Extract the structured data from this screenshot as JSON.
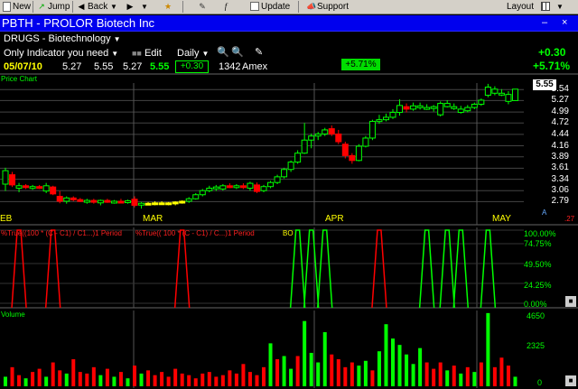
{
  "toolbar": {
    "new": "New",
    "jump": "Jump",
    "back": "Back",
    "update": "Update",
    "support": "Support",
    "layout": "Layout"
  },
  "window": {
    "title": "PBTH - PROLOR Biotech Inc",
    "minimize": "–",
    "close": "×"
  },
  "header": {
    "watchlist": "DRUGS - Biotechnology",
    "indicator": "Only Indicator you need",
    "edit": "Edit",
    "period": "Daily",
    "date": "05/07/10",
    "open": "5.27",
    "high": "5.55",
    "low": "5.27",
    "close": "5.55",
    "change": "+0.30",
    "volume": "1342",
    "exchange": "Amex",
    "pct_badge": "+5.71%",
    "right_change": "+0.30",
    "right_pct": "+5.71%"
  },
  "price_pane": {
    "title": "Price Chart",
    "last_price": "5.55",
    "axis_labels": [
      "5.54",
      "5.27",
      "4.99",
      "4.72",
      "4.44",
      "4.16",
      "3.89",
      "3.61",
      "3.34",
      "3.06",
      "2.79"
    ],
    "months": [
      "EB",
      "MAR",
      "APR",
      "MAY"
    ],
    "corner_letters": "A",
    "corner_value": ".27"
  },
  "indicator_pane": {
    "label1": "%True((100 * (C - C1) / C1...)1 Period",
    "label2": "%True(( 100 * (C - C1) / C...)1 Period",
    "label3": "BO",
    "axis_labels": [
      "100.00%",
      "74.75%",
      "49.50%",
      "24.25%",
      "0.00%"
    ]
  },
  "volume_pane": {
    "title": "Volume",
    "axis_labels": [
      "4650",
      "2325",
      "0"
    ]
  },
  "colors": {
    "up": "#00ff00",
    "down": "#ff0000",
    "neutral": "#ffff00",
    "titlebar": "#0000ee",
    "grid": "#555555"
  },
  "chart_data": {
    "type": "candlestick",
    "y_range": [
      2.6,
      5.7
    ],
    "candles": [
      {
        "o": 3.22,
        "h": 3.62,
        "l": 3.05,
        "c": 3.55,
        "d": "up"
      },
      {
        "o": 3.45,
        "h": 3.52,
        "l": 3.15,
        "c": 3.2,
        "d": "down"
      },
      {
        "o": 3.12,
        "h": 3.25,
        "l": 3.02,
        "c": 3.18,
        "d": "up"
      },
      {
        "o": 3.18,
        "h": 3.22,
        "l": 3.1,
        "c": 3.14,
        "d": "down"
      },
      {
        "o": 3.12,
        "h": 3.2,
        "l": 3.08,
        "c": 3.16,
        "d": "up"
      },
      {
        "o": 3.16,
        "h": 3.2,
        "l": 3.1,
        "c": 3.12,
        "d": "down"
      },
      {
        "o": 3.05,
        "h": 3.25,
        "l": 3.0,
        "c": 3.18,
        "d": "up"
      },
      {
        "o": 3.15,
        "h": 3.18,
        "l": 2.95,
        "c": 2.98,
        "d": "down"
      },
      {
        "o": 2.92,
        "h": 3.05,
        "l": 2.75,
        "c": 2.8,
        "d": "down"
      },
      {
        "o": 2.8,
        "h": 2.92,
        "l": 2.74,
        "c": 2.88,
        "d": "up"
      },
      {
        "o": 2.88,
        "h": 2.92,
        "l": 2.8,
        "c": 2.84,
        "d": "down"
      },
      {
        "o": 2.84,
        "h": 2.88,
        "l": 2.78,
        "c": 2.8,
        "d": "down"
      },
      {
        "o": 2.8,
        "h": 2.86,
        "l": 2.74,
        "c": 2.82,
        "d": "up"
      },
      {
        "o": 2.82,
        "h": 2.86,
        "l": 2.74,
        "c": 2.78,
        "d": "down"
      },
      {
        "o": 2.76,
        "h": 2.84,
        "l": 2.7,
        "c": 2.82,
        "d": "up"
      },
      {
        "o": 2.82,
        "h": 2.86,
        "l": 2.76,
        "c": 2.79,
        "d": "down"
      },
      {
        "o": 2.79,
        "h": 2.83,
        "l": 2.74,
        "c": 2.8,
        "d": "up"
      },
      {
        "o": 2.8,
        "h": 2.86,
        "l": 2.76,
        "c": 2.78,
        "d": "down"
      },
      {
        "o": 2.78,
        "h": 2.84,
        "l": 2.74,
        "c": 2.81,
        "d": "up"
      },
      {
        "o": 2.85,
        "h": 2.92,
        "l": 2.65,
        "c": 2.7,
        "d": "down"
      },
      {
        "o": 2.72,
        "h": 2.78,
        "l": 2.62,
        "c": 2.75,
        "d": "up"
      },
      {
        "o": 2.75,
        "h": 2.78,
        "l": 2.72,
        "c": 2.75,
        "d": "flat"
      },
      {
        "o": 2.74,
        "h": 2.8,
        "l": 2.7,
        "c": 2.76,
        "d": "flat"
      },
      {
        "o": 2.76,
        "h": 2.8,
        "l": 2.72,
        "c": 2.75,
        "d": "flat"
      },
      {
        "o": 2.74,
        "h": 2.78,
        "l": 2.7,
        "c": 2.76,
        "d": "flat"
      },
      {
        "o": 2.74,
        "h": 2.8,
        "l": 2.7,
        "c": 2.78,
        "d": "flat"
      },
      {
        "o": 2.76,
        "h": 2.82,
        "l": 2.74,
        "c": 2.8,
        "d": "flat"
      },
      {
        "o": 2.8,
        "h": 2.9,
        "l": 2.76,
        "c": 2.86,
        "d": "up"
      },
      {
        "o": 2.86,
        "h": 3.0,
        "l": 2.84,
        "c": 2.96,
        "d": "up"
      },
      {
        "o": 2.96,
        "h": 3.1,
        "l": 2.92,
        "c": 3.06,
        "d": "up"
      },
      {
        "o": 3.06,
        "h": 3.18,
        "l": 3.02,
        "c": 3.12,
        "d": "up"
      },
      {
        "o": 3.12,
        "h": 3.2,
        "l": 3.05,
        "c": 3.15,
        "d": "up"
      },
      {
        "o": 3.1,
        "h": 3.22,
        "l": 3.06,
        "c": 3.18,
        "d": "up"
      },
      {
        "o": 3.18,
        "h": 3.24,
        "l": 3.12,
        "c": 3.16,
        "d": "down"
      },
      {
        "o": 3.14,
        "h": 3.22,
        "l": 3.1,
        "c": 3.18,
        "d": "up"
      },
      {
        "o": 3.18,
        "h": 3.24,
        "l": 3.1,
        "c": 3.14,
        "d": "down"
      },
      {
        "o": 3.12,
        "h": 3.28,
        "l": 3.06,
        "c": 3.24,
        "d": "up"
      },
      {
        "o": 3.2,
        "h": 3.26,
        "l": 3.0,
        "c": 3.04,
        "d": "down"
      },
      {
        "o": 3.06,
        "h": 3.2,
        "l": 3.02,
        "c": 3.16,
        "d": "up"
      },
      {
        "o": 3.16,
        "h": 3.3,
        "l": 3.12,
        "c": 3.26,
        "d": "up"
      },
      {
        "o": 3.26,
        "h": 3.45,
        "l": 3.22,
        "c": 3.4,
        "d": "up"
      },
      {
        "o": 3.4,
        "h": 3.62,
        "l": 3.36,
        "c": 3.58,
        "d": "up"
      },
      {
        "o": 3.58,
        "h": 3.8,
        "l": 3.52,
        "c": 3.76,
        "d": "up"
      },
      {
        "o": 3.76,
        "h": 4.05,
        "l": 3.72,
        "c": 3.98,
        "d": "up"
      },
      {
        "o": 3.98,
        "h": 4.72,
        "l": 3.96,
        "c": 4.3,
        "d": "up"
      },
      {
        "o": 4.3,
        "h": 4.46,
        "l": 4.1,
        "c": 4.4,
        "d": "up"
      },
      {
        "o": 4.4,
        "h": 4.5,
        "l": 4.3,
        "c": 4.45,
        "d": "up"
      },
      {
        "o": 4.45,
        "h": 4.6,
        "l": 4.4,
        "c": 4.55,
        "d": "up"
      },
      {
        "o": 4.58,
        "h": 4.66,
        "l": 4.4,
        "c": 4.45,
        "d": "down"
      },
      {
        "o": 4.45,
        "h": 4.55,
        "l": 4.2,
        "c": 4.26,
        "d": "down"
      },
      {
        "o": 4.2,
        "h": 4.26,
        "l": 3.85,
        "c": 3.92,
        "d": "down"
      },
      {
        "o": 3.92,
        "h": 3.98,
        "l": 3.72,
        "c": 3.8,
        "d": "down"
      },
      {
        "o": 3.8,
        "h": 4.2,
        "l": 3.78,
        "c": 4.15,
        "d": "up"
      },
      {
        "o": 4.15,
        "h": 4.4,
        "l": 4.12,
        "c": 4.35,
        "d": "up"
      },
      {
        "o": 4.35,
        "h": 4.8,
        "l": 4.3,
        "c": 4.76,
        "d": "up"
      },
      {
        "o": 4.76,
        "h": 4.92,
        "l": 4.7,
        "c": 4.8,
        "d": "up"
      },
      {
        "o": 4.8,
        "h": 4.95,
        "l": 4.76,
        "c": 4.86,
        "d": "up"
      },
      {
        "o": 4.86,
        "h": 5.06,
        "l": 4.82,
        "c": 4.98,
        "d": "up"
      },
      {
        "o": 4.98,
        "h": 5.3,
        "l": 4.9,
        "c": 5.15,
        "d": "up"
      },
      {
        "o": 5.12,
        "h": 5.2,
        "l": 4.98,
        "c": 5.06,
        "d": "down"
      },
      {
        "o": 5.06,
        "h": 5.22,
        "l": 5.02,
        "c": 5.14,
        "d": "up"
      },
      {
        "o": 5.14,
        "h": 5.22,
        "l": 5.05,
        "c": 5.1,
        "d": "up"
      },
      {
        "o": 5.1,
        "h": 5.18,
        "l": 5.04,
        "c": 5.08,
        "d": "up"
      },
      {
        "o": 5.08,
        "h": 5.16,
        "l": 5.0,
        "c": 5.12,
        "d": "up"
      },
      {
        "o": 4.92,
        "h": 5.25,
        "l": 4.88,
        "c": 5.2,
        "d": "up"
      },
      {
        "o": 5.2,
        "h": 5.28,
        "l": 5.1,
        "c": 5.12,
        "d": "up"
      },
      {
        "o": 5.12,
        "h": 5.2,
        "l": 5.04,
        "c": 5.1,
        "d": "up"
      },
      {
        "o": 5.06,
        "h": 5.14,
        "l": 4.95,
        "c": 4.98,
        "d": "up"
      },
      {
        "o": 5.02,
        "h": 5.16,
        "l": 4.98,
        "c": 5.1,
        "d": "up"
      },
      {
        "o": 5.1,
        "h": 5.22,
        "l": 5.06,
        "c": 5.18,
        "d": "up"
      },
      {
        "o": 5.18,
        "h": 5.32,
        "l": 5.14,
        "c": 5.28,
        "d": "up"
      },
      {
        "o": 5.4,
        "h": 5.68,
        "l": 5.35,
        "c": 5.6,
        "d": "up"
      },
      {
        "o": 5.55,
        "h": 5.62,
        "l": 5.4,
        "c": 5.45,
        "d": "up"
      },
      {
        "o": 5.45,
        "h": 5.55,
        "l": 5.38,
        "c": 5.42,
        "d": "up"
      },
      {
        "o": 5.42,
        "h": 5.5,
        "l": 5.18,
        "c": 5.25,
        "d": "up"
      },
      {
        "o": 5.27,
        "h": 5.55,
        "l": 5.27,
        "c": 5.55,
        "d": "up"
      }
    ],
    "volume_max": 4650,
    "volume": [
      {
        "v": 600,
        "d": "up"
      },
      {
        "v": 1200,
        "d": "down"
      },
      {
        "v": 700,
        "d": "down"
      },
      {
        "v": 500,
        "d": "up"
      },
      {
        "v": 900,
        "d": "down"
      },
      {
        "v": 1100,
        "d": "down"
      },
      {
        "v": 600,
        "d": "up"
      },
      {
        "v": 1500,
        "d": "down"
      },
      {
        "v": 1000,
        "d": "down"
      },
      {
        "v": 800,
        "d": "up"
      },
      {
        "v": 1700,
        "d": "down"
      },
      {
        "v": 900,
        "d": "down"
      },
      {
        "v": 800,
        "d": "down"
      },
      {
        "v": 1200,
        "d": "down"
      },
      {
        "v": 700,
        "d": "up"
      },
      {
        "v": 1100,
        "d": "down"
      },
      {
        "v": 600,
        "d": "up"
      },
      {
        "v": 900,
        "d": "down"
      },
      {
        "v": 500,
        "d": "up"
      },
      {
        "v": 1300,
        "d": "down"
      },
      {
        "v": 800,
        "d": "up"
      },
      {
        "v": 1000,
        "d": "down"
      },
      {
        "v": 700,
        "d": "down"
      },
      {
        "v": 900,
        "d": "down"
      },
      {
        "v": 600,
        "d": "down"
      },
      {
        "v": 1100,
        "d": "down"
      },
      {
        "v": 800,
        "d": "down"
      },
      {
        "v": 700,
        "d": "down"
      },
      {
        "v": 500,
        "d": "down"
      },
      {
        "v": 800,
        "d": "down"
      },
      {
        "v": 900,
        "d": "down"
      },
      {
        "v": 600,
        "d": "down"
      },
      {
        "v": 700,
        "d": "down"
      },
      {
        "v": 1000,
        "d": "down"
      },
      {
        "v": 800,
        "d": "down"
      },
      {
        "v": 1400,
        "d": "down"
      },
      {
        "v": 900,
        "d": "down"
      },
      {
        "v": 700,
        "d": "down"
      },
      {
        "v": 1200,
        "d": "down"
      },
      {
        "v": 2700,
        "d": "up"
      },
      {
        "v": 1700,
        "d": "down"
      },
      {
        "v": 1900,
        "d": "up"
      },
      {
        "v": 1100,
        "d": "up"
      },
      {
        "v": 1900,
        "d": "down"
      },
      {
        "v": 4100,
        "d": "up"
      },
      {
        "v": 2100,
        "d": "up"
      },
      {
        "v": 1500,
        "d": "up"
      },
      {
        "v": 3400,
        "d": "up"
      },
      {
        "v": 2000,
        "d": "down"
      },
      {
        "v": 1700,
        "d": "down"
      },
      {
        "v": 1200,
        "d": "down"
      },
      {
        "v": 1500,
        "d": "down"
      },
      {
        "v": 1300,
        "d": "up"
      },
      {
        "v": 1600,
        "d": "up"
      },
      {
        "v": 1000,
        "d": "down"
      },
      {
        "v": 2200,
        "d": "up"
      },
      {
        "v": 3900,
        "d": "up"
      },
      {
        "v": 3000,
        "d": "up"
      },
      {
        "v": 2600,
        "d": "up"
      },
      {
        "v": 2000,
        "d": "up"
      },
      {
        "v": 1400,
        "d": "up"
      },
      {
        "v": 2400,
        "d": "up"
      },
      {
        "v": 1500,
        "d": "down"
      },
      {
        "v": 1100,
        "d": "down"
      },
      {
        "v": 1500,
        "d": "down"
      },
      {
        "v": 1000,
        "d": "up"
      },
      {
        "v": 1300,
        "d": "down"
      },
      {
        "v": 800,
        "d": "up"
      },
      {
        "v": 1200,
        "d": "down"
      },
      {
        "v": 900,
        "d": "up"
      },
      {
        "v": 1500,
        "d": "down"
      },
      {
        "v": 4600,
        "d": "up"
      },
      {
        "v": 1200,
        "d": "down"
      },
      {
        "v": 1800,
        "d": "down"
      },
      {
        "v": 1300,
        "d": "down"
      },
      {
        "v": 600,
        "d": "up"
      }
    ],
    "indicator_spikes": [
      {
        "center": 2,
        "d": "down"
      },
      {
        "center": 7,
        "d": "down"
      },
      {
        "center": 26,
        "d": "down"
      },
      {
        "center": 43,
        "d": "up"
      },
      {
        "center": 45,
        "d": "up"
      },
      {
        "center": 47,
        "d": "up"
      },
      {
        "center": 55,
        "d": "down"
      },
      {
        "center": 62,
        "d": "up"
      },
      {
        "center": 65,
        "d": "up"
      },
      {
        "center": 67,
        "d": "up"
      },
      {
        "center": 71,
        "d": "up"
      }
    ]
  }
}
